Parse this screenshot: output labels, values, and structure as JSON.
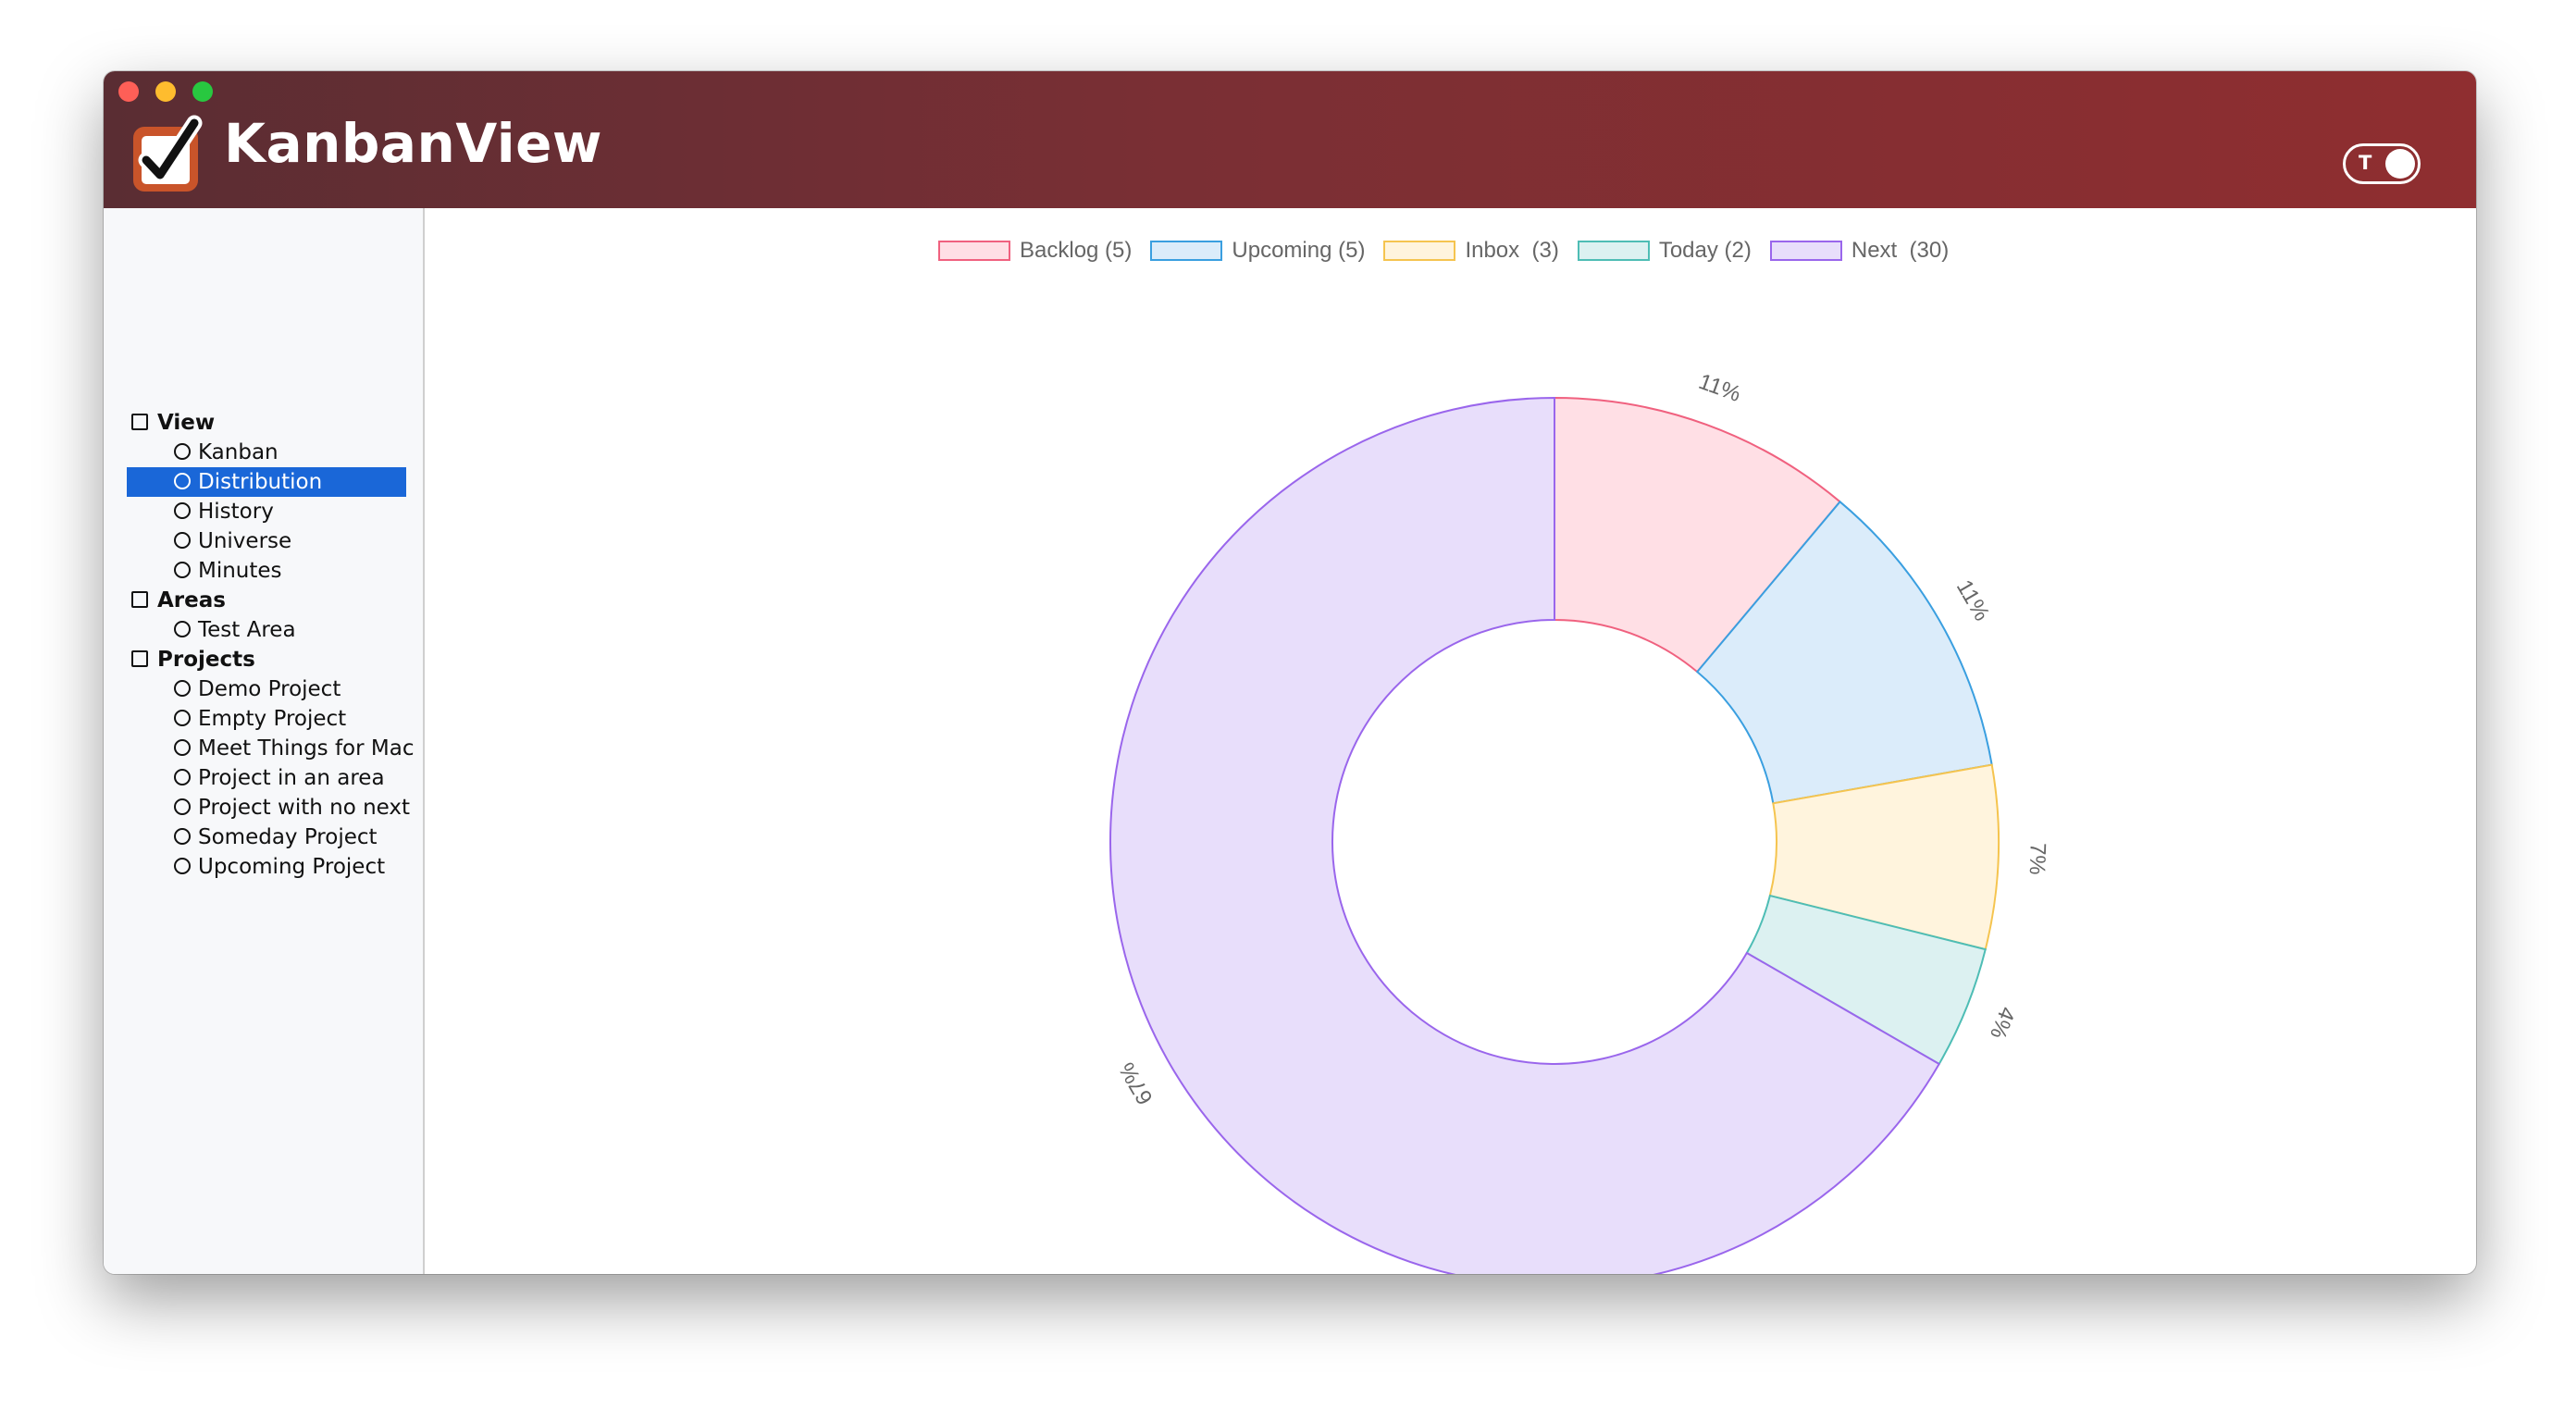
{
  "app": {
    "title": "KanbanView"
  },
  "toggle": {
    "letter": "T"
  },
  "sidebar": {
    "sections": [
      {
        "label": "View",
        "items": [
          "Kanban",
          "Distribution",
          "History",
          "Universe",
          "Minutes"
        ]
      },
      {
        "label": "Areas",
        "items": [
          "Test Area"
        ]
      },
      {
        "label": "Projects",
        "items": [
          "Demo Project",
          "Empty Project",
          "Meet Things for Mac",
          "Project in an area",
          "Project with no next",
          "Someday Project",
          "Upcoming Project"
        ]
      }
    ],
    "selected": "Distribution"
  },
  "chart_data": {
    "type": "pie",
    "variant": "doughnut",
    "title": "",
    "legend_position": "top",
    "categories": [
      "Backlog (5)",
      "Upcoming (5)",
      "Inbox  (3)",
      "Today (2)",
      "Next  (30)"
    ],
    "values": [
      5,
      5,
      3,
      2,
      30
    ],
    "percent_labels": [
      "11%",
      "11%",
      "7%",
      "4%",
      "67%"
    ],
    "colors": {
      "fill": [
        "#ffdfe5",
        "#dbecfa",
        "#fff4dd",
        "#dcf1f1",
        "#e8defb"
      ],
      "border": [
        "#f0617f",
        "#3a9fe0",
        "#f5c44f",
        "#4ebdb5",
        "#9a66ec"
      ]
    }
  }
}
